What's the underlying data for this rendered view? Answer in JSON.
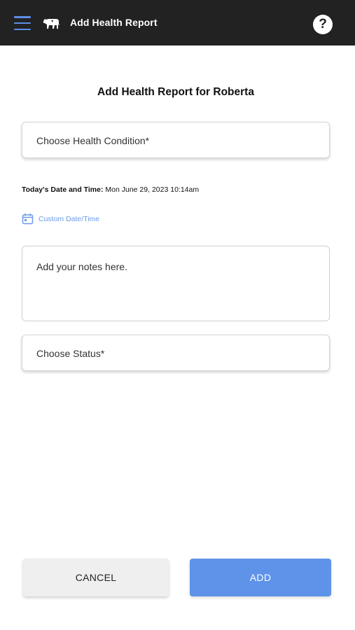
{
  "header": {
    "title": "Add Health Report",
    "menu_icon": "hamburger-menu-icon",
    "logo_icon": "cow-logo-icon",
    "help_label": "?",
    "accent_color": "#5b8fe6",
    "bar_color": "#222222"
  },
  "main": {
    "page_title": "Add Health Report for Roberta",
    "condition_field": {
      "placeholder": "Choose Health Condition*"
    },
    "datetime": {
      "label": "Today's Date and Time:",
      "value": "Mon June 29, 2023 10:14am"
    },
    "custom_datetime": {
      "label": "Custom Date/Time",
      "icon": "calendar-icon"
    },
    "notes_field": {
      "placeholder": "Add your notes here."
    },
    "status_field": {
      "placeholder": "Choose Status*"
    }
  },
  "actions": {
    "cancel_label": "CANCEL",
    "add_label": "ADD",
    "add_color": "#5e93e9"
  }
}
